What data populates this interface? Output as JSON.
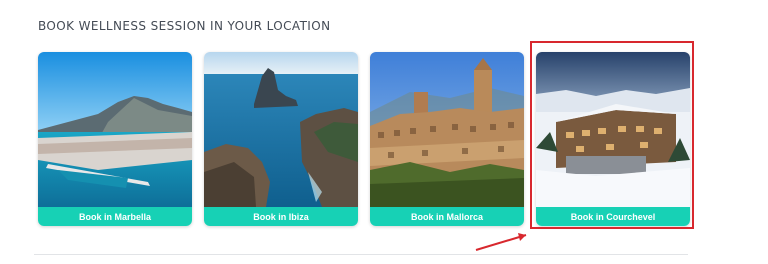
{
  "section": {
    "title": "BOOK WELLNESS SESSION IN YOUR LOCATION"
  },
  "locations": [
    {
      "label": "Book in Marbella",
      "image": "coastal-city-mountain-photo"
    },
    {
      "label": "Book in Ibiza",
      "image": "rocky-sea-island-photo"
    },
    {
      "label": "Book in Mallorca",
      "image": "hillside-village-photo"
    },
    {
      "label": "Book in Courchevel",
      "image": "snowy-chalet-photo"
    }
  ],
  "colors": {
    "button": "#17d1b5",
    "highlight": "#d8282e",
    "title": "#444b55"
  },
  "annotation": {
    "highlighted_card": "Book in Courchevel"
  }
}
